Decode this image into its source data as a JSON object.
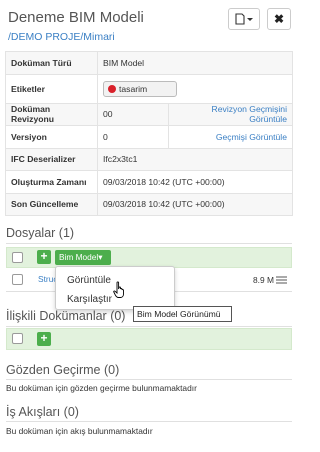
{
  "header": {
    "title": "Deneme BIM Modeli",
    "breadcrumb": "/DEMO PROJE/Mimari",
    "doc_button_icon": "document-icon",
    "close_button_icon": "close-icon",
    "close_label": "✖"
  },
  "properties": {
    "doc_type_label": "Doküman Türü",
    "doc_type_value": "BIM Model",
    "tags_label": "Etiketler",
    "tag_value": "tasarim",
    "tag_color": "#d9202a",
    "revision_label": "Doküman Revizyonu",
    "revision_value": "00",
    "revision_action": "Revizyon Geçmişini Görüntüle",
    "version_label": "Versiyon",
    "version_value": "0",
    "version_action": "Geçmişi Görüntüle",
    "ifc_label": "IFC Deserializer",
    "ifc_value": "Ifc2x3tc1",
    "created_label": "Oluşturma Zamanı",
    "created_value": "09/03/2018 10:42 (UTC +00:00)",
    "updated_label": "Son Güncelleme",
    "updated_value": "09/03/2018 10:42 (UTC +00:00)"
  },
  "files": {
    "title": "Dosyalar (1)",
    "bim_button_label": "Bim Model▾",
    "file_name": "Struc",
    "file_size": "8.9 M",
    "dropdown": {
      "view_label": "Görüntüle",
      "compare_label": "Karşılaştır"
    },
    "tooltip": "Bim Model Görünümü"
  },
  "related": {
    "title": "İlişkili Dokümanlar (0)"
  },
  "reviews": {
    "title": "Gözden Geçirme (0)",
    "empty": "Bu doküman için gözden geçirme bulunmamaktadır"
  },
  "workflows": {
    "title": "İş Akışları (0)",
    "empty": "Bu doküman için akış bulunmamaktadır"
  },
  "colors": {
    "accent_green": "#4cae4c",
    "link_blue": "#3a7fc4",
    "section_green_bg": "#e2f2dd"
  }
}
